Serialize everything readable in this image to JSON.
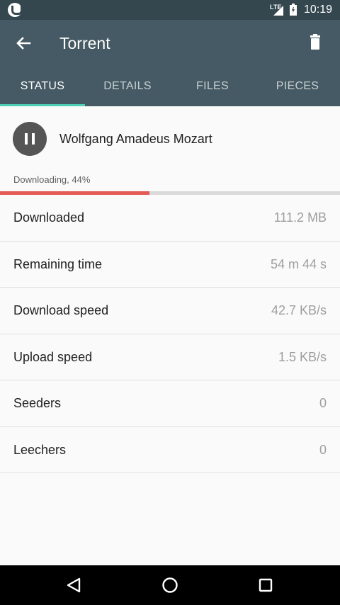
{
  "statusbar": {
    "network": "LTE",
    "time": "10:19"
  },
  "appbar": {
    "title": "Torrent"
  },
  "tabs": [
    {
      "label": "STATUS",
      "active": true
    },
    {
      "label": "DETAILS",
      "active": false
    },
    {
      "label": "FILES",
      "active": false
    },
    {
      "label": "PIECES",
      "active": false
    }
  ],
  "torrent": {
    "name": "Wolfgang Amadeus Mozart",
    "status": "Downloading, 44%",
    "progress_percent": 44
  },
  "stats": [
    {
      "label": "Downloaded",
      "value": "111.2 MB"
    },
    {
      "label": "Remaining time",
      "value": "54 m 44 s"
    },
    {
      "label": "Download speed",
      "value": "42.7 KB/s"
    },
    {
      "label": "Upload speed",
      "value": "1.5 KB/s"
    },
    {
      "label": "Seeders",
      "value": "0"
    },
    {
      "label": "Leechers",
      "value": "0"
    }
  ],
  "colors": {
    "appbar": "#455a64",
    "statusbar": "#34474f",
    "tab_indicator": "#4dd0b5",
    "progress": "#e45a55"
  }
}
